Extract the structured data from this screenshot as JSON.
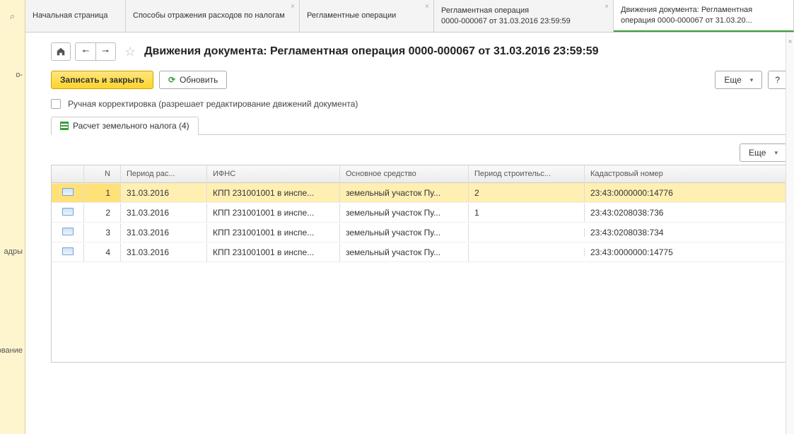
{
  "sidebar": {
    "items": [
      "о-",
      "адры",
      "ование"
    ]
  },
  "tabs": [
    {
      "title": "Начальная страница",
      "closable": false
    },
    {
      "title": "Способы отражения расходов по налогам",
      "closable": true
    },
    {
      "title": "Регламентные операции",
      "closable": true
    },
    {
      "title": "Регламентная операция\n0000-000067 от 31.03.2016 23:59:59",
      "closable": true
    },
    {
      "title": "Движения документа: Регламентная операция 0000-000067 от 31.03.20...",
      "closable": true,
      "active": true
    }
  ],
  "page": {
    "title": "Движения документа: Регламентная операция 0000-000067 от 31.03.2016 23:59:59"
  },
  "toolbar": {
    "save_close": "Записать и закрыть",
    "refresh": "Обновить",
    "more": "Еще",
    "help": "?"
  },
  "checkbox": {
    "label": "Ручная корректировка (разрешает редактирование движений документа)"
  },
  "sub_tab": {
    "label": "Расчет земельного налога (4)"
  },
  "grid": {
    "columns": {
      "n": "N",
      "period": "Период рас...",
      "ifns": "ИФНС",
      "asset": "Основное средство",
      "build": "Период строительс...",
      "cadastr": "Кадастровый номер"
    },
    "rows": [
      {
        "n": "1",
        "period": "31.03.2016",
        "ifns": "КПП 231001001 в инспе...",
        "asset": "земельный участок Пу...",
        "build": "2",
        "cadastr": "23:43:0000000:14776",
        "selected": true
      },
      {
        "n": "2",
        "period": "31.03.2016",
        "ifns": "КПП 231001001 в инспе...",
        "asset": "земельный участок Пу...",
        "build": "1",
        "cadastr": "23:43:0208038:736"
      },
      {
        "n": "3",
        "period": "31.03.2016",
        "ifns": "КПП 231001001 в инспе...",
        "asset": "земельный участок Пу...",
        "build": "",
        "cadastr": "23:43:0208038:734"
      },
      {
        "n": "4",
        "period": "31.03.2016",
        "ifns": "КПП 231001001 в инспе...",
        "asset": "земельный участок Пу...",
        "build": "",
        "cadastr": "23:43:0000000:14775"
      }
    ]
  }
}
